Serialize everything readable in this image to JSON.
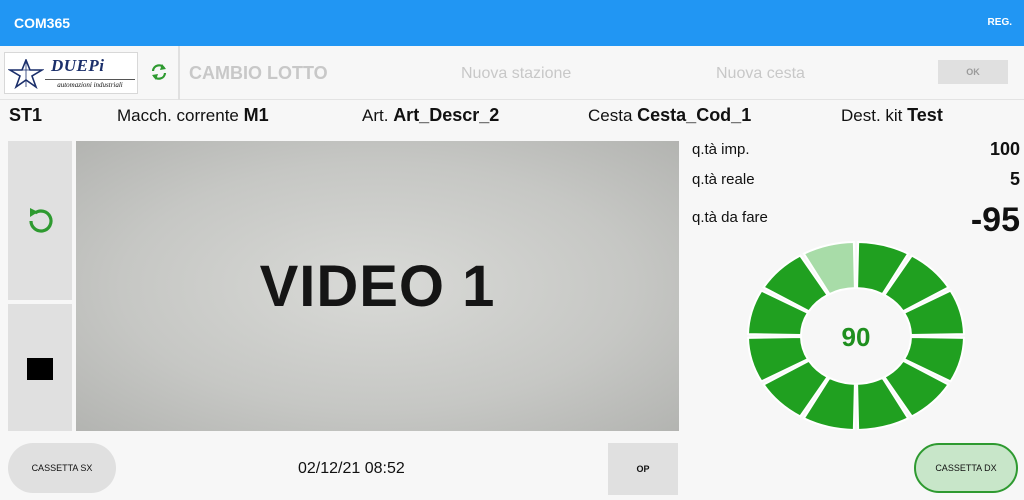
{
  "appbar": {
    "title": "COM365",
    "reg_label": "REG."
  },
  "logo": {
    "brand": "DUEPi",
    "tagline": "automazioni industriali"
  },
  "toolbar": {
    "cambio_lotto": "CAMBIO LOTTO",
    "nuova_stazione": "Nuova stazione",
    "nuova_cesta": "Nuova cesta",
    "ok_label": "OK",
    "sync_icon": "sync-icon"
  },
  "info": {
    "station": "ST1",
    "macchina_label": "Macch. corrente",
    "macchina_value": "M1",
    "art_label": "Art.",
    "art_value": "Art_Descr_2",
    "cesta_label": "Cesta",
    "cesta_value": "Cesta_Cod_1",
    "dest_label": "Dest. kit",
    "dest_value": "Test"
  },
  "video": {
    "label": "VIDEO 1"
  },
  "side_buttons": {
    "top_icon": "refresh-icon",
    "bottom_icon": "stop-icon"
  },
  "quantities": {
    "imp_label": "q.tà imp.",
    "imp_value": "100",
    "reale_label": "q.tà reale",
    "reale_value": "5",
    "da_fare_label": "q.tà da fare",
    "da_fare_value": "-95"
  },
  "donut": {
    "center_value": "90",
    "segments_total": 12,
    "segments_done": 11,
    "colors": {
      "done": "#20a020",
      "remaining": "#a8dca8",
      "center_text": "#1e8f1e"
    }
  },
  "footer": {
    "cassetta_sx": "CASSETTA SX",
    "datetime": "02/12/21 08:52",
    "op_label": "OP",
    "cassetta_dx": "CASSETTA DX"
  },
  "colors": {
    "appbar": "#2196f3",
    "accent_green": "#2e9a30"
  }
}
